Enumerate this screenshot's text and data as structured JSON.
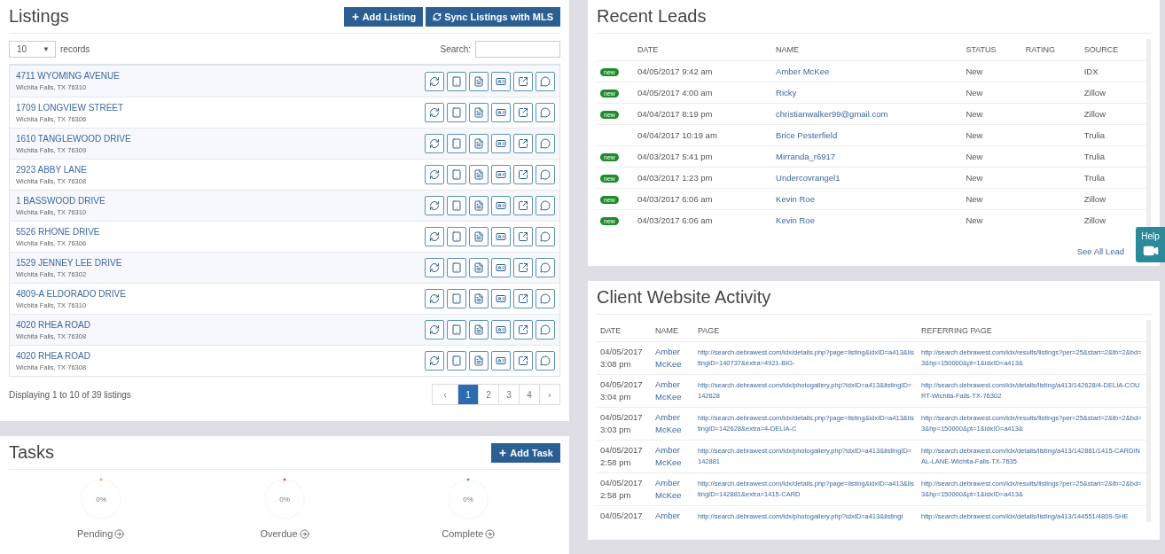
{
  "listings": {
    "title": "Listings",
    "buttons": [
      {
        "label": "Add Listing",
        "kind": "add"
      },
      {
        "label": "Sync Listings with MLS",
        "kind": "sync"
      }
    ],
    "page_size": "10",
    "page_size_caret": "▼",
    "records_label": "records",
    "search_label": "Search:",
    "rows": [
      {
        "address": "4711 WYOMING AVENUE",
        "city": "Wichita Falls, TX 76310"
      },
      {
        "address": "1709 LONGVIEW STREET",
        "city": "Wichita Falls, TX 76306"
      },
      {
        "address": "1610 TANGLEWOOD DRIVE",
        "city": "Wichita Falls, TX 76309"
      },
      {
        "address": "2923 ABBY LANE",
        "city": "Wichita Falls, TX 76308"
      },
      {
        "address": "1 BASSWOOD DRIVE",
        "city": "Wichita Falls, TX 76310"
      },
      {
        "address": "5526 RHONE DRIVE",
        "city": "Wichita Falls, TX 76306"
      },
      {
        "address": "1529 JENNEY LEE DRIVE",
        "city": "Wichita Falls, TX 76302"
      },
      {
        "address": "4809-A ELDORADO DRIVE",
        "city": "Wichita Falls, TX 76310"
      },
      {
        "address": "4020 RHEA ROAD",
        "city": "Wichita Falls, TX 76308"
      },
      {
        "address": "4020 RHEA ROAD",
        "city": "Wichita Falls, TX 76308"
      }
    ],
    "summary": "Displaying 1 to 10 of 39 listings",
    "pagination": {
      "prev": "‹",
      "next": "›",
      "pages": [
        {
          "label": "1",
          "selected": true
        },
        {
          "label": "2",
          "selected": false
        },
        {
          "label": "3",
          "selected": false
        },
        {
          "label": "4",
          "selected": false
        }
      ]
    }
  },
  "tasks": {
    "title": "Tasks",
    "button": "Add Task",
    "gauges": [
      {
        "label": "Pending",
        "value": "0%",
        "color": "#f0ad4e"
      },
      {
        "label": "Overdue",
        "value": "0%",
        "color": "#e74c5c"
      },
      {
        "label": "Complete",
        "value": "0%",
        "color": "#3bb4a8"
      }
    ]
  },
  "recent_leads": {
    "title": "Recent Leads",
    "columns": [
      "DATE",
      "NAME",
      "STATUS",
      "RATING",
      "SOURCE"
    ],
    "rows": [
      {
        "is_new": true,
        "badge": "new",
        "date": "04/05/2017 9:42 am",
        "name": "Amber McKee",
        "status": "New",
        "source": "IDX"
      },
      {
        "is_new": true,
        "badge": "new",
        "date": "04/05/2017 4:00 am",
        "name": "Ricky",
        "status": "New",
        "source": "Zillow"
      },
      {
        "is_new": true,
        "badge": "new",
        "date": "04/04/2017 8:19 pm",
        "name": "christianwalker99@gmail.com",
        "status": "New",
        "source": "Zillow"
      },
      {
        "is_new": false,
        "date": "04/04/2017 10:19 am",
        "name": "Brice Pesterfield",
        "status": "New",
        "source": "Trulia"
      },
      {
        "is_new": true,
        "badge": "new",
        "date": "04/03/2017 5:41 pm",
        "name": "Mirranda_r6917",
        "status": "New",
        "source": "Trulia"
      },
      {
        "is_new": true,
        "badge": "new",
        "date": "04/03/2017 1:23 pm",
        "name": "Undercovrangel1",
        "status": "New",
        "source": "Trulia"
      },
      {
        "is_new": true,
        "badge": "new",
        "date": "04/03/2017 6:06 am",
        "name": "Kevin Roe",
        "status": "New",
        "source": "Zillow"
      },
      {
        "is_new": true,
        "badge": "new",
        "date": "04/03/2017 6:06 am",
        "name": "Kevin Roe",
        "status": "New",
        "source": "Zillow"
      }
    ],
    "see_all": "See All Lead"
  },
  "activity": {
    "title": "Client Website Activity",
    "columns": [
      "DATE",
      "NAME",
      "PAGE",
      "REFERRING PAGE"
    ],
    "rows": [
      {
        "date": "04/05/2017",
        "time": "3:08 pm",
        "first": "Amber",
        "last": "McKee",
        "page": "http://search.debrawest.com/idx/details.php?page=listing&idxID=a413&listingID=140737&extra=4921-BIG-",
        "referrer": "http://search.debrawest.com/idx/results/listings?per=25&start=2&tb=2&bd=3&hp=150000&pt=1&idxID=a413&"
      },
      {
        "date": "04/05/2017",
        "time": "3:04 pm",
        "first": "Amber",
        "last": "McKee",
        "page": "http://search.debrawest.com/idx/photogallery.php?idxID=a413&listingID=142628",
        "referrer": "http://search.debrawest.com/idx/details/listing/a413/142628/4-DELIA-COURT-Wichita-Falls-TX-76302"
      },
      {
        "date": "04/05/2017",
        "time": "3:03 pm",
        "first": "Amber",
        "last": "McKee",
        "page": "http://search.debrawest.com/idx/details.php?page=listing&idxID=a413&listingID=142628&extra=4-DELIA-C",
        "referrer": "http://search.debrawest.com/idx/results/listings?per=25&start=2&tb=2&bd=3&hp=150000&pt=1&idxID=a413&"
      },
      {
        "date": "04/05/2017",
        "time": "2:58 pm",
        "first": "Amber",
        "last": "McKee",
        "page": "http://search.debrawest.com/idx/photogallery.php?idxID=a413&listingID=142881",
        "referrer": "http://search.debrawest.com/idx/details/listing/a413/142881/1415-CARDINAL-LANE-Wichita-Falls-TX-7635"
      },
      {
        "date": "04/05/2017",
        "time": "2:58 pm",
        "first": "Amber",
        "last": "McKee",
        "page": "http://search.debrawest.com/idx/details.php?page=listing&idxID=a413&listingID=142881&extra=1415-CARD",
        "referrer": "http://search.debrawest.com/idx/results/listings?per=25&start=2&tb=2&bd=3&hp=150000&pt=1&idxID=a413&"
      },
      {
        "date": "04/05/2017",
        "first": "Amber",
        "page": "http://search.debrawest.com/idx/photogallery.php?idxID=a413&listingI",
        "referrer": "http://search.debrawest.com/idx/details/listing/a413/144551/4809-SHE"
      }
    ]
  },
  "help": {
    "label": "Help"
  }
}
